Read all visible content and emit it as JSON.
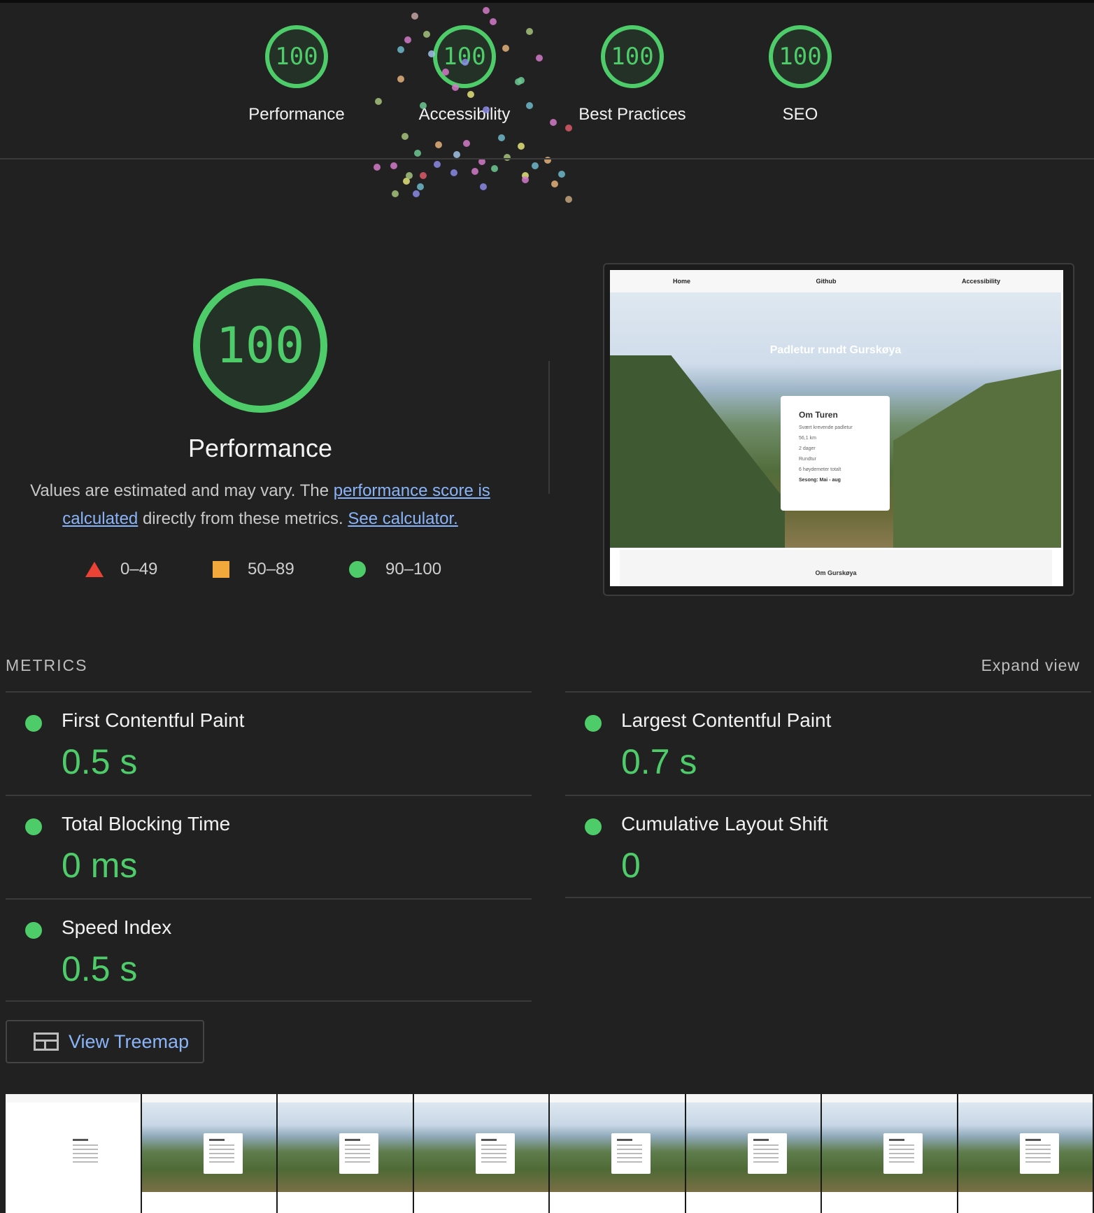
{
  "gauges": [
    {
      "label": "Performance",
      "score": "100"
    },
    {
      "label": "Accessibility",
      "score": "100"
    },
    {
      "label": "Best Practices",
      "score": "100"
    },
    {
      "label": "SEO",
      "score": "100"
    }
  ],
  "performance": {
    "score": "100",
    "title": "Performance",
    "desc_prefix": "Values are estimated and may vary. The ",
    "desc_link1": "performance score is calculated",
    "desc_mid": " directly from these metrics. ",
    "desc_link2": "See calculator.",
    "legend": {
      "fail": "0–49",
      "average": "50–89",
      "pass": "90–100"
    }
  },
  "screenshot": {
    "nav": [
      "Home",
      "Github",
      "Accessibility"
    ],
    "hero_title": "Padletur rundt Gurskøya",
    "card_title": "Om Turen",
    "card_items": [
      "Svært krevende padletur",
      "56,1 km",
      "2 dager",
      "Rundtur",
      "6 høydemeter totalt",
      "Sesong: Mai - aug"
    ],
    "section_title": "Om Gurskøya"
  },
  "metrics": {
    "heading": "METRICS",
    "expand": "Expand view",
    "items": [
      {
        "title": "First Contentful Paint",
        "value": "0.5 s"
      },
      {
        "title": "Largest Contentful Paint",
        "value": "0.7 s"
      },
      {
        "title": "Total Blocking Time",
        "value": "0 ms"
      },
      {
        "title": "Cumulative Layout Shift",
        "value": "0"
      },
      {
        "title": "Speed Index",
        "value": "0.5 s"
      }
    ]
  },
  "treemap_label": "View Treemap",
  "colors": {
    "pass": "#4fcc6a",
    "average": "#f3a83b",
    "fail": "#ea4335",
    "link": "#8ab4f8",
    "background": "#212121"
  }
}
